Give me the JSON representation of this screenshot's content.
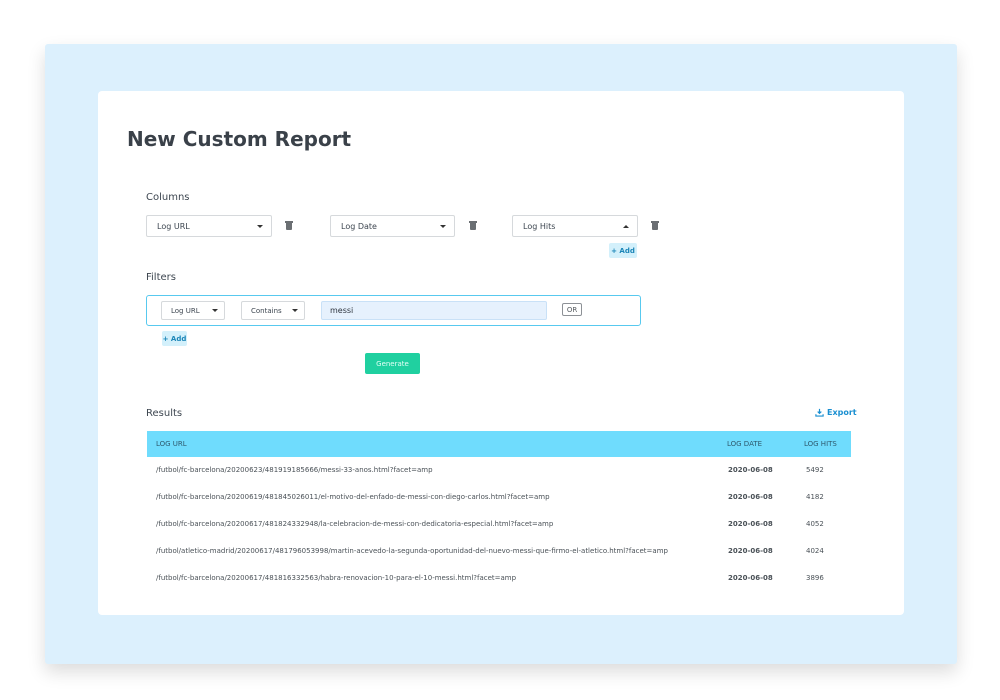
{
  "page": {
    "title": "New Custom Report"
  },
  "columns": {
    "label": "Columns",
    "selects": [
      {
        "value": "Log URL"
      },
      {
        "value": "Log Date"
      },
      {
        "value": "Log Hits"
      }
    ],
    "add_label": "+ Add"
  },
  "filters": {
    "label": "Filters",
    "field": "Log URL",
    "operator": "Contains",
    "value": "messi",
    "or_label": "OR",
    "add_label": "+ Add"
  },
  "generate_label": "Generate",
  "results": {
    "label": "Results",
    "export_label": "Export",
    "headers": [
      "LOG URL",
      "LOG DATE",
      "LOG HITS"
    ],
    "rows": [
      {
        "url": "/futbol/fc-barcelona/20200623/481919185666/messi-33-anos.html?facet=amp",
        "date": "2020-06-08",
        "hits": "5492"
      },
      {
        "url": "/futbol/fc-barcelona/20200619/481845026011/el-motivo-del-enfado-de-messi-con-diego-carlos.html?facet=amp",
        "date": "2020-06-08",
        "hits": "4182"
      },
      {
        "url": "/futbol/fc-barcelona/20200617/481824332948/la-celebracion-de-messi-con-dedicatoria-especial.html?facet=amp",
        "date": "2020-06-08",
        "hits": "4052"
      },
      {
        "url": "/futbol/atletico-madrid/20200617/481796053998/martin-acevedo-la-segunda-oportunidad-del-nuevo-messi-que-firmo-el-atletico.html?facet=amp",
        "date": "2020-06-08",
        "hits": "4024"
      },
      {
        "url": "/futbol/fc-barcelona/20200617/481816332563/habra-renovacion-10-para-el-10-messi.html?facet=amp",
        "date": "2020-06-08",
        "hits": "3896"
      }
    ]
  },
  "colors": {
    "frame_bg": "#dcf0fd",
    "accent": "#6fdcfd",
    "generate": "#20d0a0",
    "export": "#1a8fd1"
  },
  "icons": {
    "delete": "trash-icon",
    "export": "download-icon"
  }
}
